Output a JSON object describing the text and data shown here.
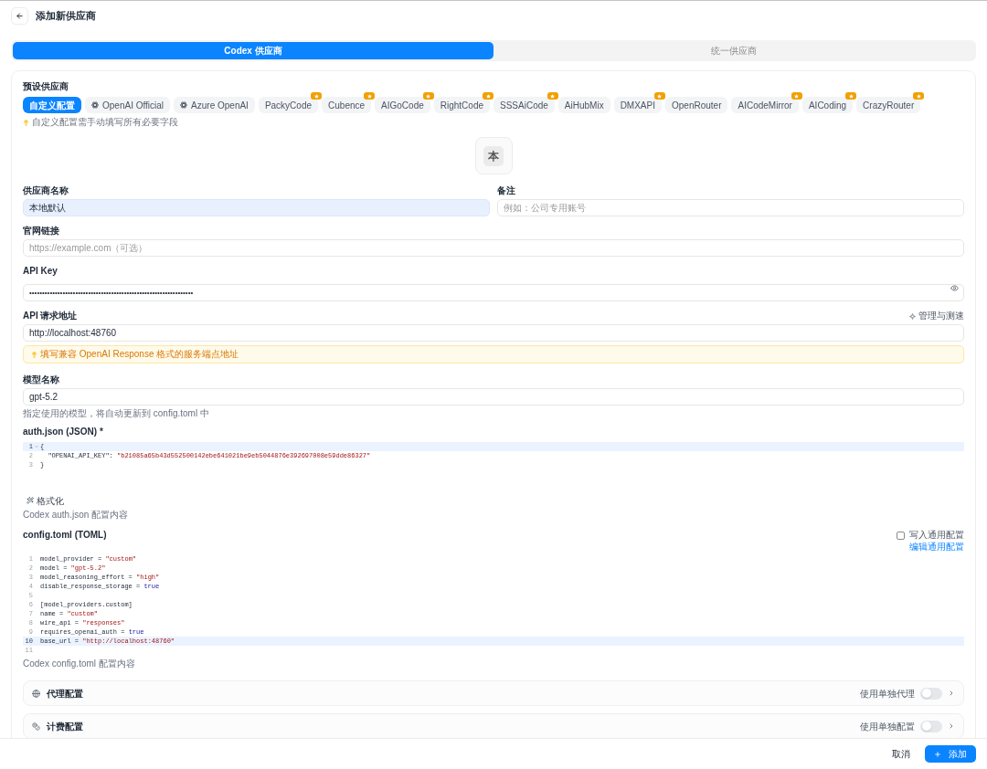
{
  "header": {
    "title": "添加新供应商"
  },
  "tabs": [
    {
      "label": "Codex 供应商",
      "selected": true
    },
    {
      "label": "统一供应商",
      "selected": false
    }
  ],
  "presets": {
    "label": "预设供应商",
    "items": [
      {
        "label": "自定义配置",
        "kind": "plain",
        "selected": true,
        "featured": false
      },
      {
        "label": "OpenAI Official",
        "kind": "logo",
        "selected": false,
        "featured": false
      },
      {
        "label": "Azure OpenAI",
        "kind": "logo",
        "selected": false,
        "featured": false
      },
      {
        "label": "PackyCode",
        "kind": "plain",
        "selected": false,
        "featured": true
      },
      {
        "label": "Cubence",
        "kind": "plain",
        "selected": false,
        "featured": true
      },
      {
        "label": "AIGoCode",
        "kind": "plain",
        "selected": false,
        "featured": true
      },
      {
        "label": "RightCode",
        "kind": "plain",
        "selected": false,
        "featured": true
      },
      {
        "label": "SSSAiCode",
        "kind": "plain",
        "selected": false,
        "featured": true
      },
      {
        "label": "AiHubMix",
        "kind": "plain",
        "selected": false,
        "featured": false
      },
      {
        "label": "DMXAPI",
        "kind": "plain",
        "selected": false,
        "featured": true
      },
      {
        "label": "OpenRouter",
        "kind": "plain",
        "selected": false,
        "featured": false
      },
      {
        "label": "AICodeMirror",
        "kind": "plain",
        "selected": false,
        "featured": true
      },
      {
        "label": "AICoding",
        "kind": "plain",
        "selected": false,
        "featured": true
      },
      {
        "label": "CrazyRouter",
        "kind": "plain",
        "selected": false,
        "featured": true
      }
    ],
    "hint": "自定义配置需手动填写所有必要字段"
  },
  "avatar": {
    "text": "本"
  },
  "name_field": {
    "label": "供应商名称",
    "value": "本地默认",
    "autofilled": true
  },
  "notes_field": {
    "label": "备注",
    "placeholder": "例如：公司专用账号"
  },
  "website_field": {
    "label": "官网链接",
    "placeholder": "https://example.com（可选）"
  },
  "api_key_field": {
    "label": "API Key",
    "value": "••••••••••••••••••••••••••••••••••••••••••••••••••••••••••••••••"
  },
  "api_url_field": {
    "label": "API 请求地址",
    "action": "管理与测速",
    "value": "http://localhost:48760",
    "notice": "填写兼容 OpenAI Response 格式的服务端点地址"
  },
  "model_field": {
    "label": "模型名称",
    "value": "gpt-5.2",
    "hint": "指定使用的模型，将自动更新到 config.toml 中"
  },
  "auth_json": {
    "label": "auth.json (JSON) *",
    "lines": [
      {
        "number": "1",
        "active": true,
        "foldable": true,
        "tokens": [
          {
            "kind": "plain",
            "text": "{"
          }
        ]
      },
      {
        "number": "2",
        "active": false,
        "foldable": false,
        "tokens": [
          {
            "kind": "plain",
            "text": "  \"OPENAI_API_KEY\": "
          },
          {
            "kind": "string",
            "text": "\"b21085a65b43d552500142ebe641021be9eb5044876e392697008e59dde86327\""
          }
        ]
      },
      {
        "number": "3",
        "active": false,
        "foldable": false,
        "tokens": [
          {
            "kind": "plain",
            "text": "}"
          }
        ]
      }
    ],
    "format_button": "格式化",
    "hint": "Codex auth.json 配置内容"
  },
  "config_toml": {
    "label": "config.toml (TOML)",
    "write_common": {
      "label": "写入通用配置",
      "checked": false
    },
    "edit_link": "编辑通用配置",
    "lines": [
      {
        "number": "1",
        "active": false,
        "foldable": false,
        "tokens": [
          {
            "kind": "plain",
            "text": "model_provider = "
          },
          {
            "kind": "string",
            "text": "\"custom\""
          }
        ]
      },
      {
        "number": "2",
        "active": false,
        "foldable": false,
        "tokens": [
          {
            "kind": "plain",
            "text": "model = "
          },
          {
            "kind": "string",
            "text": "\"gpt-5.2\""
          }
        ]
      },
      {
        "number": "3",
        "active": false,
        "foldable": false,
        "tokens": [
          {
            "kind": "plain",
            "text": "model_reasoning_effort = "
          },
          {
            "kind": "string",
            "text": "\"high\""
          }
        ]
      },
      {
        "number": "4",
        "active": false,
        "foldable": false,
        "tokens": [
          {
            "kind": "plain",
            "text": "disable_response_storage = "
          },
          {
            "kind": "keyword",
            "text": "true"
          }
        ]
      },
      {
        "number": "5",
        "active": false,
        "foldable": false
      },
      {
        "number": "6",
        "active": false,
        "foldable": false,
        "tokens": [
          {
            "kind": "plain",
            "text": "[model_providers.custom]"
          }
        ]
      },
      {
        "number": "7",
        "active": false,
        "foldable": false,
        "tokens": [
          {
            "kind": "plain",
            "text": "name = "
          },
          {
            "kind": "string",
            "text": "\"custom\""
          }
        ]
      },
      {
        "number": "8",
        "active": false,
        "foldable": false,
        "tokens": [
          {
            "kind": "plain",
            "text": "wire_api = "
          },
          {
            "kind": "string",
            "text": "\"responses\""
          }
        ]
      },
      {
        "number": "9",
        "active": false,
        "foldable": false,
        "tokens": [
          {
            "kind": "plain",
            "text": "requires_openai_auth = "
          },
          {
            "kind": "keyword",
            "text": "true"
          }
        ]
      },
      {
        "number": "10",
        "active": true,
        "foldable": false,
        "tokens": [
          {
            "kind": "plain",
            "text": "base_url = "
          },
          {
            "kind": "string",
            "text": "\"http://localhost:48760\""
          }
        ]
      },
      {
        "number": "11",
        "active": false,
        "foldable": false
      }
    ],
    "hint": "Codex config.toml 配置内容"
  },
  "sections": [
    {
      "kind": "proxy",
      "title": "代理配置",
      "toggle_label": "使用单独代理",
      "on": false
    },
    {
      "kind": "billing",
      "title": "计费配置",
      "toggle_label": "使用单独配置",
      "on": false
    }
  ],
  "footer": {
    "cancel": "取消",
    "submit": "添加"
  }
}
